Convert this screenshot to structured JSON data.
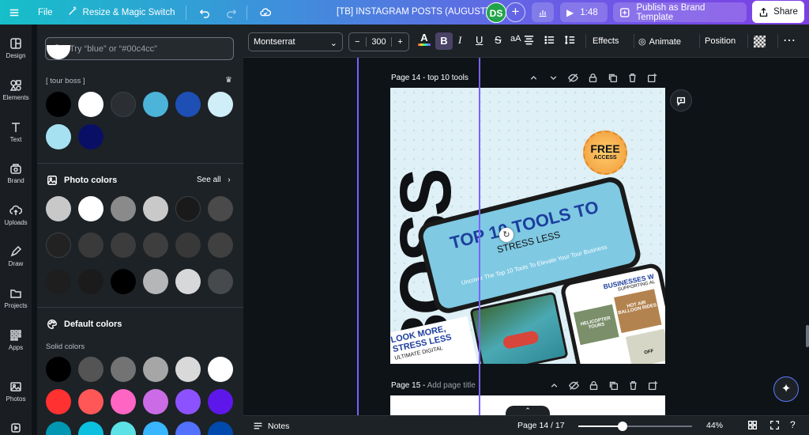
{
  "topbar": {
    "file": "File",
    "resize": "Resize & Magic Switch",
    "doc_title": "[TB] INSTAGRAM POSTS (AUGUST)",
    "avatar_initials": "DS",
    "timer": "1:48",
    "publish": "Publish as Brand Template",
    "share": "Share"
  },
  "rail": {
    "items": [
      "Design",
      "Elements",
      "Text",
      "Brand",
      "Uploads",
      "Draw",
      "Projects",
      "Apps",
      "Photos"
    ]
  },
  "panel": {
    "search_placeholder": "Try “blue” or “#00c4cc”",
    "brand_kit_label": "[ tour boss ]",
    "brand_colors": [
      "#000000",
      "#ffffff",
      "#2b2f33",
      "#4cb3d9",
      "#1e4fb5",
      "#cfeef8",
      "#a6e1f2",
      "#0a0f66"
    ],
    "photo_colors_title": "Photo colors",
    "see_all": "See all",
    "photo_colors": [
      "#c8c8c8",
      "#ffffff",
      "#8a8a8a",
      "#c9c9c9",
      "#1a1a1a",
      "#4a4a4a",
      "#222222",
      "#3a3a3a",
      "#3c3c3c",
      "#3e3e3e",
      "#383838",
      "#404040",
      "#1e1e1e",
      "#1b1b1b",
      "#000000",
      "#b4b6b8",
      "#d7d8da",
      "#474a4d"
    ],
    "default_colors_title": "Default colors",
    "solid_colors_label": "Solid colors",
    "solid_colors": [
      "#000000",
      "#545454",
      "#737373",
      "#a6a6a6",
      "#d9d9d9",
      "#ffffff",
      "#ff3131",
      "#ff5757",
      "#ff66c4",
      "#cb6ce6",
      "#8c52ff",
      "#5e17eb",
      "#0097b2",
      "#0cc0df",
      "#5ce1e6",
      "#38b6ff",
      "#5271ff",
      "#004aad"
    ]
  },
  "toolbar": {
    "font": "Montserrat",
    "size": "300",
    "effects": "Effects",
    "animate": "Animate",
    "position": "Position"
  },
  "canvas": {
    "page14_label": "Page 14 - top 10 tools",
    "page15_label": "Page 15 - ",
    "page15_placeholder": "Add page title",
    "design": {
      "big_text": "BOSS",
      "free_badge": "FREE",
      "free_sub": "ACCESS",
      "headline": "TOP 10 TOOLS TO",
      "subline": "STRESS LESS",
      "tagline": "Uncover The Top 10 Tools To Elevate Your Tour Business",
      "card_left_title": "LOOK MORE, STRESS LESS",
      "card_left_sub": "ULTIMATE DIGITAL",
      "card_right_title": "BUSINESSES W",
      "card_right_sub": "SUPPORTING AL",
      "tile1": "HELICOPTER TOURS",
      "tile2": "HOT AIR BALLOON RIDES",
      "tile3": "OFF"
    }
  },
  "bottombar": {
    "notes": "Notes",
    "page_indicator": "Page 14 / 17",
    "zoom": "44%",
    "zoom_fraction": 0.39
  }
}
